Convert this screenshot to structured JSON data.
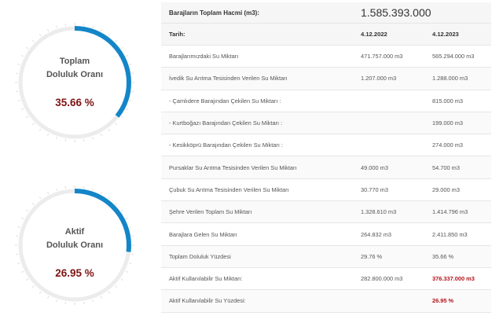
{
  "gauges": [
    {
      "title_line1": "Toplam",
      "title_line2": "Doluluk Oranı",
      "value": "35.66 %",
      "fraction": 0.3566
    },
    {
      "title_line1": "Aktif",
      "title_line2": "Doluluk Oranı",
      "value": "26.95 %",
      "fraction": 0.2695
    }
  ],
  "colors": {
    "gauge_fill": "#1486c8",
    "gauge_track": "#ececec",
    "value_text": "#7f1414",
    "highlight": "#b5121b"
  },
  "table": {
    "header_label": "Barajların Toplam Hacmi (m3):",
    "header_value": "1.585.393.000",
    "date_label": "Tarih:",
    "date_col1": "4.12.2022",
    "date_col2": "4.12.2023",
    "rows": [
      {
        "label": "Barajlarımızdaki Su Miktarı",
        "v1": "471.757.000 m3",
        "v2": "565.294.000 m3"
      },
      {
        "label": "İvedik Su Arıtma Tesisinden Verilen Su Miktarı",
        "v1": "1.207.000 m3",
        "v2": "1.288.000 m3"
      },
      {
        "label": "- Çamlıdere Barajından Çekilen Su Miktarı :",
        "v1": "",
        "v2": "815.000 m3"
      },
      {
        "label": "- Kurtboğazı Barajından Çekilen Su Miktarı :",
        "v1": "",
        "v2": "199.000 m3"
      },
      {
        "label": "- Kesikköprü Barajından Çekilen Su Miktarı :",
        "v1": "",
        "v2": "274.000 m3"
      },
      {
        "label": "Pursaklar Su Arıtma Tesisinden Verilen Su Miktarı",
        "v1": "49.000 m3",
        "v2": "54.700 m3"
      },
      {
        "label": "Çubuk Su Arıtma Tesisinden Verilen Su Miktarı",
        "v1": "30.770 m3",
        "v2": "29.000 m3"
      },
      {
        "label": "Şehre Verilen Toplam Su Miktarı",
        "v1": "1.328.610 m3",
        "v2": "1.414.796 m3"
      },
      {
        "label": "Barajlara Gelen Su Miktarı",
        "v1": "264.832 m3",
        "v2": "2.411.850 m3"
      },
      {
        "label": "Toplam Doluluk Yüzdesi",
        "v1": "29.76 %",
        "v2": "35.66 %"
      },
      {
        "label": "Aktif Kullanılabilir Su Miktarı:",
        "v1": "282.800.000 m3",
        "v2": "376.337.000 m3"
      },
      {
        "label": "Aktif Kullanılabilir Su Yüzdesi:",
        "v1": "",
        "v2": "26.95 %"
      }
    ]
  }
}
